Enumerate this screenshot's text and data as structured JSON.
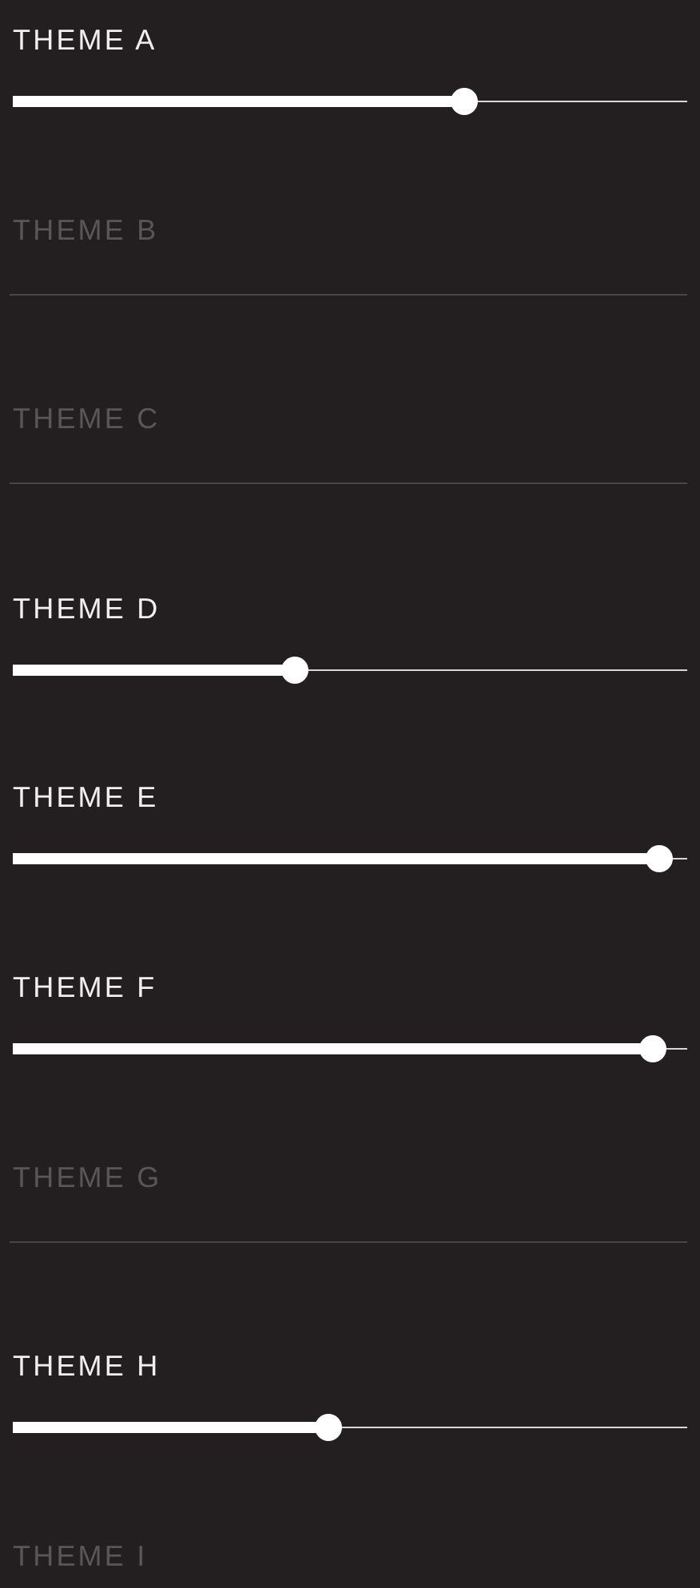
{
  "themes": [
    {
      "label": "THEME A",
      "disabled": false,
      "level": 0.67
    },
    {
      "label": "THEME B",
      "disabled": true
    },
    {
      "label": "THEME C",
      "disabled": true
    },
    {
      "label": "THEME D",
      "disabled": false,
      "level": 0.42
    },
    {
      "label": "THEME E",
      "disabled": false,
      "level": 0.96
    },
    {
      "label": "THEME F",
      "disabled": false,
      "level": 0.95
    },
    {
      "label": "THEME G",
      "disabled": true
    },
    {
      "label": "THEME H",
      "disabled": false,
      "level": 0.47
    },
    {
      "label": "THEME I",
      "disabled": true
    }
  ]
}
